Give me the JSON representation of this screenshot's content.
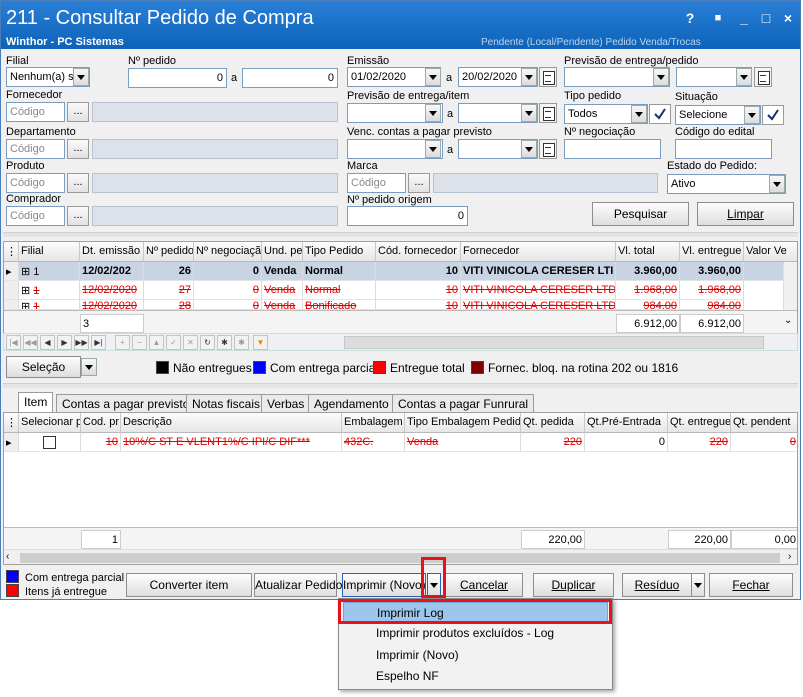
{
  "window": {
    "title": "211 - Consultar Pedido de Compra",
    "subtitle": "Winthor - PC Sistemas",
    "ghost_text": "Pendente (Local/Pendente)   Pedido   Venda/Trocas",
    "controls": [
      "?",
      "■",
      "_",
      "□",
      "×"
    ]
  },
  "filters": {
    "filial": {
      "label": "Filial",
      "value": "Nenhum(a) se"
    },
    "numero_pedido": {
      "label": "Nº pedido",
      "from": "0",
      "sep": "a",
      "to": "0"
    },
    "emissao": {
      "label": "Emissão",
      "from": "01/02/2020",
      "sep": "a",
      "to": "20/02/2020"
    },
    "previsao_entrega_pedido": {
      "label": "Previsão de entrega/pedido",
      "from": "",
      "sep": "a",
      "to": ""
    },
    "fornecedor": {
      "label": "Fornecedor",
      "placeholder": "Código",
      "button": "...",
      "name": ""
    },
    "previsao_entrega_item": {
      "label": "Previsão de entrega/item",
      "from": "",
      "sep": "a",
      "to": ""
    },
    "tipo_pedido": {
      "label": "Tipo pedido",
      "value": "Todos"
    },
    "situacao": {
      "label": "Situação",
      "value": "Selecione"
    },
    "departamento": {
      "label": "Departamento",
      "placeholder": "Código",
      "button": "..."
    },
    "venc_contas": {
      "label": "Venc. contas a  pagar previsto",
      "from": "",
      "sep": "a",
      "to": ""
    },
    "num_negociacao": {
      "label": "Nº negociação",
      "value": ""
    },
    "codigo_edital": {
      "label": "Código do edital",
      "value": ""
    },
    "produto": {
      "label": "Produto",
      "placeholder": "Código",
      "button": "..."
    },
    "marca": {
      "label": "Marca",
      "placeholder": "Código",
      "button": "..."
    },
    "estado_pedido": {
      "label": "Estado do Pedido:",
      "value": "Ativo"
    },
    "comprador": {
      "label": "Comprador",
      "placeholder": "Código",
      "button": "..."
    },
    "pedido_origem": {
      "label": "Nº pedido origem",
      "value": "0"
    }
  },
  "buttons": {
    "pesquisar": "Pesquisar",
    "limpar": "Limpar"
  },
  "orders_grid": {
    "columns": [
      "Filial",
      "Dt. emissão",
      "Nº pedido",
      "Nº negociação",
      "Und. pe",
      "Tipo Pedido",
      "Cód. fornecedor",
      "Fornecedor",
      "Vl. total",
      "Vl. entregue",
      "Valor Ve"
    ],
    "rows": [
      {
        "filial": "1",
        "dt": "12/02/202",
        "pedido": "26",
        "neg": "0",
        "und": "Venda",
        "tipo": "Normal",
        "cod": "10",
        "forn": "VITI VINICOLA CERESER LTI",
        "total": "3.960,00",
        "entregue": "3.960,00",
        "style": "bold"
      },
      {
        "filial": "1",
        "dt": "12/02/2020",
        "pedido": "27",
        "neg": "0",
        "und": "Venda",
        "tipo": "Normal",
        "cod": "10",
        "forn": "VITI VINICOLA CERESER LTDA.",
        "total": "1.968,00",
        "entregue": "1.968,00",
        "style": "strike"
      },
      {
        "filial": "1",
        "dt": "12/02/2020",
        "pedido": "28",
        "neg": "0",
        "und": "Venda",
        "tipo": "Bonificado",
        "cod": "10",
        "forn": "VITI VINICOLA CERESER LTDA.",
        "total": "984,00",
        "entregue": "984,00",
        "style": "strike"
      }
    ],
    "footer": {
      "count": "3",
      "total": "6.912,00",
      "entregue": "6.912,00"
    }
  },
  "selecao_button": "Seleção",
  "legend": [
    {
      "label": "Não entregues",
      "color": "#000000"
    },
    {
      "label": "Com entrega parcial",
      "color": "#0000ff"
    },
    {
      "label": "Entregue total",
      "color": "#ff0000"
    },
    {
      "label": "Fornec. bloq. na rotina 202 ou 1816",
      "color": "#800000"
    }
  ],
  "tabs": [
    "Item",
    "Contas a pagar previsto",
    "Notas fiscais",
    "Verbas",
    "Agendamento",
    "Contas a pagar Funrural"
  ],
  "items_grid": {
    "columns": [
      "Selecionar p",
      "Cod. pr",
      "Descrição",
      "Embalagem",
      "Tipo Embalagem Pedido",
      "Qt. pedida",
      "Qt.Pré-Entrada",
      "Qt. entregue",
      "Qt. pendent"
    ],
    "rows": [
      {
        "cod": "10",
        "desc": "10%/C ST E VLENT1%/C IPI/C DIF***",
        "emb": "432C.",
        "tipo": "Venda",
        "qt_pedida": "220",
        "pre": "0",
        "entregue": "220",
        "pendente": "0"
      }
    ],
    "footer": {
      "count": "1",
      "qt_pedida": "220,00",
      "entregue": "220,00",
      "pendente": "0,00"
    }
  },
  "bottom_legend": [
    {
      "label": "Com entrega parcial",
      "color": "#0000ff"
    },
    {
      "label": "Itens já entregue",
      "color": "#ff0000"
    }
  ],
  "bottom_buttons": {
    "converter": "Converter item",
    "atualizar": "Atualizar Pedido",
    "imprimir": "Imprimir (Novo)",
    "cancelar": "Cancelar",
    "duplicar": "Duplicar",
    "residuo": "Resíduo",
    "fechar": "Fechar"
  },
  "print_menu": [
    "Imprimir Log",
    "Imprimir produtos excluídos - Log",
    "Imprimir (Novo)",
    "Espelho NF"
  ],
  "colors": {
    "titlebar": "#1a72c8",
    "highlight": "#e8121c",
    "menu_selected": "#9ec5ec"
  }
}
